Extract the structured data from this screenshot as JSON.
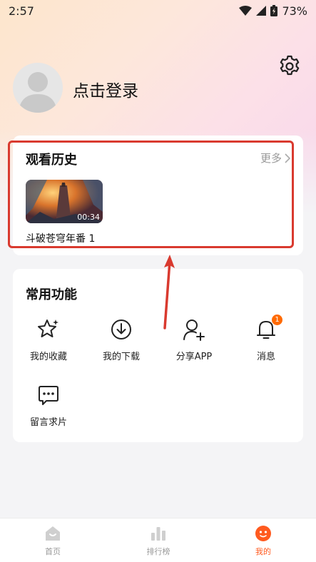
{
  "status_bar": {
    "time": "2:57",
    "battery": "73%"
  },
  "profile": {
    "login_label": "点击登录"
  },
  "history": {
    "title": "观看历史",
    "more_label": "更多",
    "items": [
      {
        "title": "斗破苍穹年番 1",
        "duration": "00:34"
      }
    ]
  },
  "functions": {
    "title": "常用功能",
    "items": [
      {
        "label": "我的收藏",
        "icon": "star-icon"
      },
      {
        "label": "我的下载",
        "icon": "download-icon"
      },
      {
        "label": "分享APP",
        "icon": "add-user-icon"
      },
      {
        "label": "消息",
        "icon": "bell-icon",
        "badge": "1"
      },
      {
        "label": "留言求片",
        "icon": "chat-icon"
      }
    ]
  },
  "tabbar": {
    "items": [
      {
        "label": "首页",
        "icon": "home-icon"
      },
      {
        "label": "排行榜",
        "icon": "ranking-icon"
      },
      {
        "label": "我的",
        "icon": "profile-face-icon",
        "active": true
      }
    ]
  },
  "colors": {
    "accent": "#ff5a1f",
    "highlight_border": "#d93a2f",
    "badge": "#ff6a00"
  }
}
